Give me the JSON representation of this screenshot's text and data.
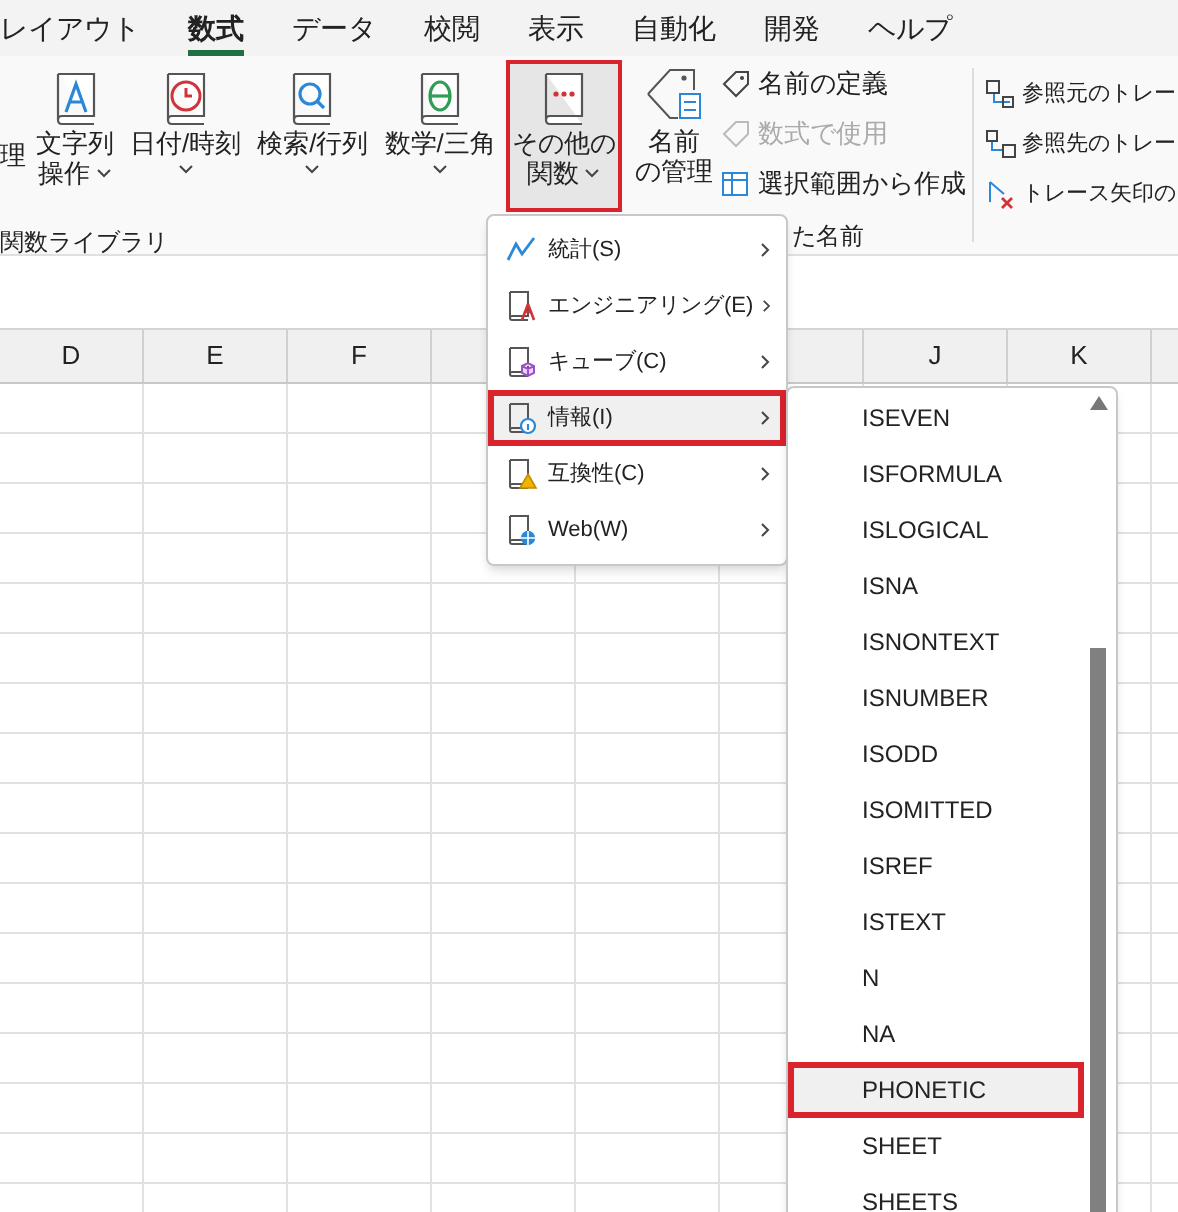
{
  "tabs": [
    {
      "label": "レイアウト",
      "selected": false
    },
    {
      "label": "数式",
      "selected": true
    },
    {
      "label": "データ",
      "selected": false
    },
    {
      "label": "校閲",
      "selected": false
    },
    {
      "label": "表示",
      "selected": false
    },
    {
      "label": "自動化",
      "selected": false
    },
    {
      "label": "開発",
      "selected": false
    },
    {
      "label": "ヘルプ",
      "selected": false
    }
  ],
  "library": {
    "cut_label": "理",
    "buttons": [
      {
        "kind": "text",
        "lines": [
          "文字列",
          "操作"
        ],
        "selected": false
      },
      {
        "kind": "clock",
        "lines": [
          "日付/時刻"
        ],
        "selected": false
      },
      {
        "kind": "search",
        "lines": [
          "検索/行列"
        ],
        "selected": false
      },
      {
        "kind": "theta",
        "lines": [
          "数学/三角"
        ],
        "selected": false
      },
      {
        "kind": "more",
        "lines": [
          "その他の",
          "関数"
        ],
        "selected": true
      }
    ],
    "group_label": "関数ライブラリ"
  },
  "names": {
    "manager": [
      "名前",
      "の管理"
    ],
    "items": [
      {
        "kind": "tag",
        "label": "名前の定義",
        "disabled": false
      },
      {
        "kind": "fx",
        "label": "数式で使用",
        "disabled": true
      },
      {
        "kind": "grid",
        "label": "選択範囲から作成",
        "disabled": false
      }
    ],
    "group_label": "た名前"
  },
  "audit": {
    "items": [
      {
        "kind": "precedents",
        "label": "参照元のトレー"
      },
      {
        "kind": "dependents",
        "label": "参照先のトレー"
      },
      {
        "kind": "remove",
        "label": "トレース矢印の"
      }
    ]
  },
  "columns": [
    {
      "label": "D"
    },
    {
      "label": "E"
    },
    {
      "label": "F"
    },
    {},
    {},
    {},
    {
      "label": "J"
    },
    {
      "label": "K"
    }
  ],
  "menu": [
    {
      "kind": "chart",
      "label": "統計(S)",
      "selected": false
    },
    {
      "kind": "compass",
      "label": "エンジニアリング(E)",
      "selected": false
    },
    {
      "kind": "cube",
      "label": "キューブ(C)",
      "selected": false
    },
    {
      "kind": "info",
      "label": "情報(I)",
      "selected": true
    },
    {
      "kind": "warning",
      "label": "互換性(C)",
      "selected": false
    },
    {
      "kind": "globe",
      "label": "Web(W)",
      "selected": false
    }
  ],
  "submenu": [
    {
      "label": "ISEVEN",
      "selected": false
    },
    {
      "label": "ISFORMULA",
      "selected": false
    },
    {
      "label": "ISLOGICAL",
      "selected": false
    },
    {
      "label": "ISNA",
      "selected": false
    },
    {
      "label": "ISNONTEXT",
      "selected": false
    },
    {
      "label": "ISNUMBER",
      "selected": false
    },
    {
      "label": "ISODD",
      "selected": false
    },
    {
      "label": "ISOMITTED",
      "selected": false
    },
    {
      "label": "ISREF",
      "selected": false
    },
    {
      "label": "ISTEXT",
      "selected": false
    },
    {
      "label": "N",
      "selected": false
    },
    {
      "label": "NA",
      "selected": false
    },
    {
      "label": "PHONETIC",
      "selected": true
    },
    {
      "label": "SHEET",
      "selected": false
    },
    {
      "label": "SHEETS",
      "selected": false
    }
  ]
}
